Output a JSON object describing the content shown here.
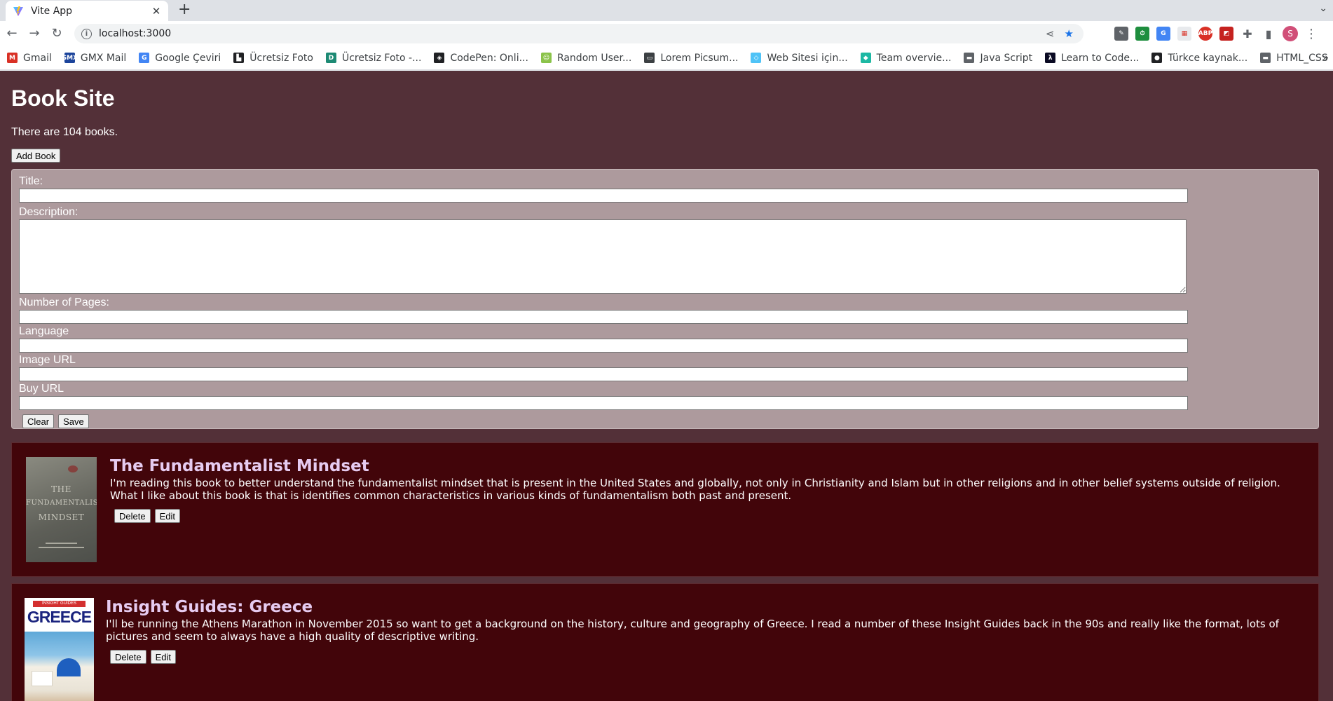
{
  "browser": {
    "tab_title": "Vite App",
    "tab_close": "✕",
    "new_tab": "+",
    "url": "localhost:3000",
    "bookmarks": [
      {
        "label": "Gmail",
        "icon": "gmail-icon",
        "color": "#d93025"
      },
      {
        "label": "GMX Mail",
        "icon": "gmx-icon",
        "color": "#1c449b"
      },
      {
        "label": "Google Çeviri",
        "icon": "translate-icon",
        "color": "#4285f4"
      },
      {
        "label": "Ücretsiz Foto",
        "icon": "camera-icon",
        "color": "#202124"
      },
      {
        "label": "Ücretsiz Foto -...",
        "icon": "photo-icon",
        "color": "#1d8a74"
      },
      {
        "label": "CodePen: Onli...",
        "icon": "codepen-icon",
        "color": "#202124"
      },
      {
        "label": "Random User...",
        "icon": "random-user-icon",
        "color": "#8bc34a"
      },
      {
        "label": "Lorem Picsum...",
        "icon": "picsum-icon",
        "color": "#3c4043"
      },
      {
        "label": "Web Sitesi için...",
        "icon": "diamond-outline-icon",
        "color": "#4fc3f7"
      },
      {
        "label": "Team overvie...",
        "icon": "diamond-icon",
        "color": "#1db8a4"
      },
      {
        "label": "Java Script",
        "icon": "folder-icon",
        "color": "#5f6368"
      },
      {
        "label": "Learn to Code...",
        "icon": "freecodecamp-icon",
        "color": "#0a0a23"
      },
      {
        "label": "Türkce kaynak...",
        "icon": "github-icon",
        "color": "#202124"
      },
      {
        "label": "HTML_CSS",
        "icon": "folder-icon",
        "color": "#5f6368"
      }
    ],
    "more_bookmarks": "»"
  },
  "page": {
    "site_title": "Book Site",
    "count_text": "There are 104 books.",
    "add_button": "Add Book"
  },
  "form": {
    "title_label": "Title:",
    "title_value": "",
    "description_label": "Description:",
    "description_value": "",
    "pages_label": "Number of Pages:",
    "pages_value": "",
    "language_label": "Language",
    "language_value": "",
    "image_label": "Image URL",
    "image_value": "",
    "buy_label": "Buy URL",
    "buy_value": "",
    "clear_button": "Clear",
    "save_button": "Save"
  },
  "books": [
    {
      "title": "The Fundamentalist Mindset",
      "description": "I'm reading this book to better understand the fundamentalist mindset that is present in the United States and globally, not only in Christianity and Islam but in other religions and in other belief systems outside of religion. What I like about this book is that is identifies common characteristics in various kinds of fundamentalism both past and present.",
      "delete_label": "Delete",
      "edit_label": "Edit",
      "cover_lines": [
        "THE",
        "FUNDAMENTALIST",
        "MINDSET"
      ]
    },
    {
      "title": "Insight Guides: Greece",
      "description": "I'll be running the Athens Marathon in November 2015 so want to get a background on the history, culture and geography of Greece. I read a number of these Insight Guides back in the 90s and really like the format, lots of pictures and seem to always have a high quality of descriptive writing.",
      "delete_label": "Delete",
      "edit_label": "Edit",
      "cover_brand": "INSIGHT GUIDES",
      "cover_title": "GREECE"
    }
  ],
  "colors": {
    "page_bg": "#533038",
    "form_bg": "#ad9a9d",
    "card_bg": "#42050a",
    "book_title": "#e6cbf0"
  }
}
